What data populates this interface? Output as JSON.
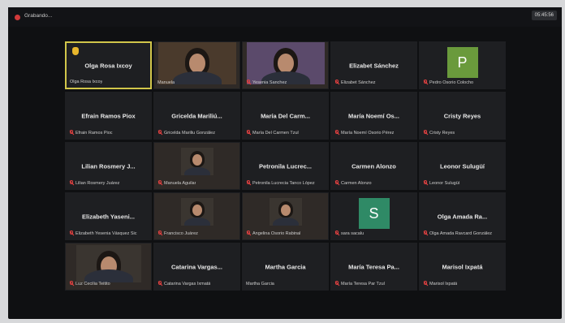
{
  "app": {
    "title": "Grabando...",
    "clock": "05:45:56"
  },
  "colors": {
    "active_border": "#d1c64a",
    "muted_mic": "#e04040",
    "avatar_green": "#6a9a3c",
    "avatar_teal": "#2f8a66"
  },
  "participants": [
    {
      "center": "Olga Rosa Ixcoy",
      "label": "Olga Rosa Ixcoy",
      "muted": false,
      "active": true,
      "hand": true
    },
    {
      "center": "",
      "label": "Manuela",
      "muted": false,
      "video": true
    },
    {
      "center": "",
      "label": "Yesenia Sanchez",
      "muted": true,
      "video": true
    },
    {
      "center": "Elizabet Sánchez",
      "label": "Elizabet Sánchez",
      "muted": true
    },
    {
      "center": "",
      "label": "Pedro Osorio Colocho",
      "muted": true,
      "avatar": "P"
    },
    {
      "center": "Efrain Ramos Piox",
      "label": "Efrain Ramos Pioc",
      "muted": true
    },
    {
      "center": "Gricelda Mariliú...",
      "label": "Gricelda Mariliu González",
      "muted": true
    },
    {
      "center": "María Del Carm...",
      "label": "María Del Carmen Tzul",
      "muted": true
    },
    {
      "center": "María Noemí Os...",
      "label": "María Noemí Osorio Pérez",
      "muted": true
    },
    {
      "center": "Cristy Reyes",
      "label": "Cristy Reyes",
      "muted": true
    },
    {
      "center": "Lilian Rosmery J...",
      "label": "Lilian Rosmery Juárez",
      "muted": true
    },
    {
      "center": "",
      "label": "Manuela Aguilar",
      "muted": true,
      "video": true
    },
    {
      "center": "Petronila  Lucrec...",
      "label": "Petronila Lucrecia Tanco López",
      "muted": true
    },
    {
      "center": "Carmen Alonzo",
      "label": "Carmen Alonzo",
      "muted": true
    },
    {
      "center": "Leonor Sulugüí",
      "label": "Leonor Sulugüí",
      "muted": true
    },
    {
      "center": "Elizabeth Yaseni...",
      "label": "Elizabeth Yesenia Vásquez Sic",
      "muted": true
    },
    {
      "center": "",
      "label": "Francisco Juárez",
      "muted": true,
      "video": true
    },
    {
      "center": "",
      "label": "Angelina Osorio Rabinal",
      "muted": true,
      "video": true
    },
    {
      "center": "",
      "label": "sara sacalu",
      "muted": true,
      "avatar": "S"
    },
    {
      "center": "Olga Amada Ra...",
      "label": "Olga Amada Ravcard González",
      "muted": true
    },
    {
      "center": "",
      "label": "Luz Cecilia Teitito",
      "muted": true,
      "video": true,
      "big": true
    },
    {
      "center": "Catarina  Vargas...",
      "label": "Catarina Vargas Ixmatá",
      "muted": true
    },
    {
      "center": "Martha Garcia",
      "label": "Martha Garcia",
      "muted": false
    },
    {
      "center": "María Teresa Pa...",
      "label": "María Teresa Par Tzul",
      "muted": true
    },
    {
      "center": "Marisol Ixpatá",
      "label": "Marisol Ixpatá",
      "muted": true
    }
  ]
}
